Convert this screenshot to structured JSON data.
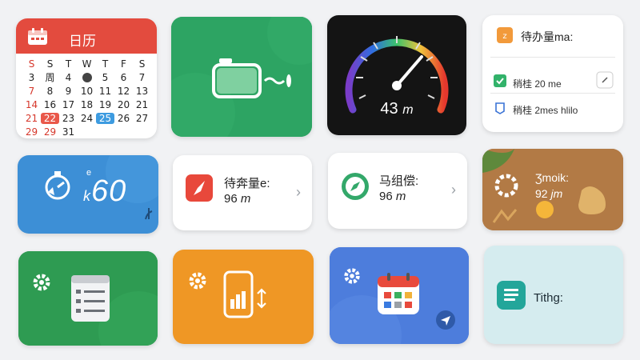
{
  "calendar": {
    "title": "日历",
    "weekdays": [
      "S",
      "S",
      "T",
      "W",
      "T",
      "F",
      "S"
    ],
    "rows": [
      [
        "",
        "",
        "",
        "",
        "",
        "",
        ""
      ],
      [
        "3",
        "周",
        "4",
        "",
        "5",
        "6",
        "7"
      ],
      [
        "7",
        "8",
        "9",
        "10",
        "11",
        "12",
        "13"
      ],
      [
        "14",
        "16",
        "17",
        "18",
        "19",
        "20",
        "21"
      ],
      [
        "21",
        "22",
        "23",
        "24",
        "25",
        "26",
        "27"
      ],
      [
        "29",
        "29",
        "31",
        "",
        "",
        "",
        ""
      ]
    ]
  },
  "speedometer": {
    "value": "43",
    "unit": "m"
  },
  "tasks": {
    "title": "待办量ma:",
    "items": [
      {
        "label": "稍桂 20 me"
      },
      {
        "label": "稍桂 2mes hlilo"
      }
    ]
  },
  "timer": {
    "small": "e",
    "display": "60",
    "prefix": "k"
  },
  "run_tile": {
    "title": "待奔量e:",
    "value": "96",
    "unit": "m",
    "chevron": "›"
  },
  "compass_tile": {
    "title": "马组偿:",
    "value": "96",
    "unit": "m",
    "chevron": "›"
  },
  "weather": {
    "title": "Ʒmoik:",
    "value": "92",
    "unit": "jm"
  },
  "docs": {
    "label": "Tithg:"
  },
  "colors": {
    "red": "#e34b3e",
    "green": "#2da463",
    "blue": "#3d8fd6",
    "orange": "#ef9725",
    "indigo": "#4d7ddc",
    "brown": "#b27a45"
  }
}
